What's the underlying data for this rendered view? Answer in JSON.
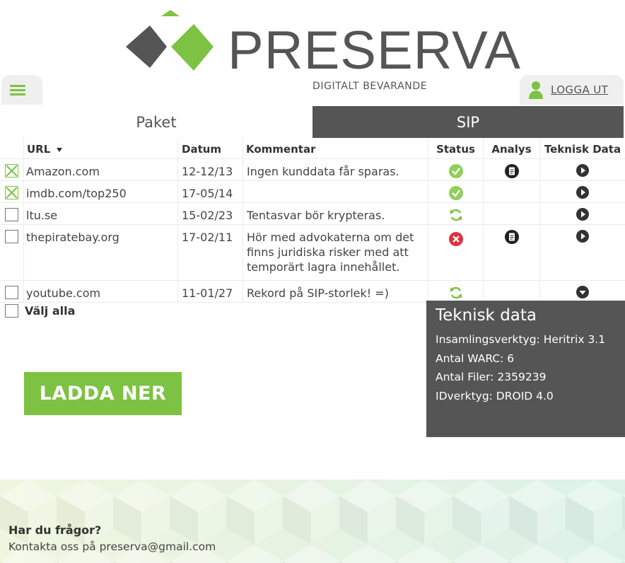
{
  "brand": {
    "name": "PRESERVA",
    "tagline": "DIGITALT BEVARANDE",
    "green": "#7dc242",
    "dark": "#555555"
  },
  "header": {
    "menu_icon": "hamburger-icon",
    "logout_label": "LOGGA UT",
    "user_icon": "user-icon"
  },
  "tabs": [
    {
      "label": "Paket",
      "active": false
    },
    {
      "label": "SIP",
      "active": true
    }
  ],
  "table": {
    "columns": {
      "url": "URL",
      "date": "Datum",
      "comment": "Kommentar",
      "status": "Status",
      "analysis": "Analys",
      "tech": "Teknisk Data"
    },
    "sort_icon": "caret-down-icon",
    "rows": [
      {
        "checked": true,
        "url": "Amazon.com",
        "date": "12-12/13",
        "comment": "Ingen kunddata får sparas.",
        "status": "ok",
        "analysis": true,
        "tech_icon": "play-circle-icon"
      },
      {
        "checked": true,
        "url": "imdb.com/top250",
        "date": "17-05/14",
        "comment": "",
        "status": "ok",
        "analysis": false,
        "tech_icon": "play-circle-icon"
      },
      {
        "checked": false,
        "url": "ltu.se",
        "date": "15-02/23",
        "comment": "Tentasvar bör krypteras.",
        "status": "processing",
        "analysis": false,
        "tech_icon": "play-circle-icon"
      },
      {
        "checked": false,
        "url": "thepiratebay.org",
        "date": "17-02/11",
        "comment": "Hör med advokaterna om det finns juridiska risker med att temporärt lagra innehållet.",
        "status": "error",
        "analysis": true,
        "tech_icon": "play-circle-icon"
      },
      {
        "checked": false,
        "url": "youtube.com",
        "date": "11-01/27",
        "comment": "Rekord på SIP-storlek! =)",
        "status": "processing",
        "analysis": false,
        "tech_icon": "chevron-down-circle-icon"
      }
    ]
  },
  "select_all": {
    "label": "Välj alla"
  },
  "download": {
    "label": "LADDA NER"
  },
  "tech_panel": {
    "title": "Teknisk data",
    "lines": [
      "Insamlingsverktyg: Heritrix 3.1",
      "Antal WARC: 6",
      "Antal Filer: 2359239",
      "IDverktyg: DROID 4.0"
    ]
  },
  "footer": {
    "question": "Har du frågor?",
    "contact": "Kontakta oss på preserva@gmail.com"
  }
}
